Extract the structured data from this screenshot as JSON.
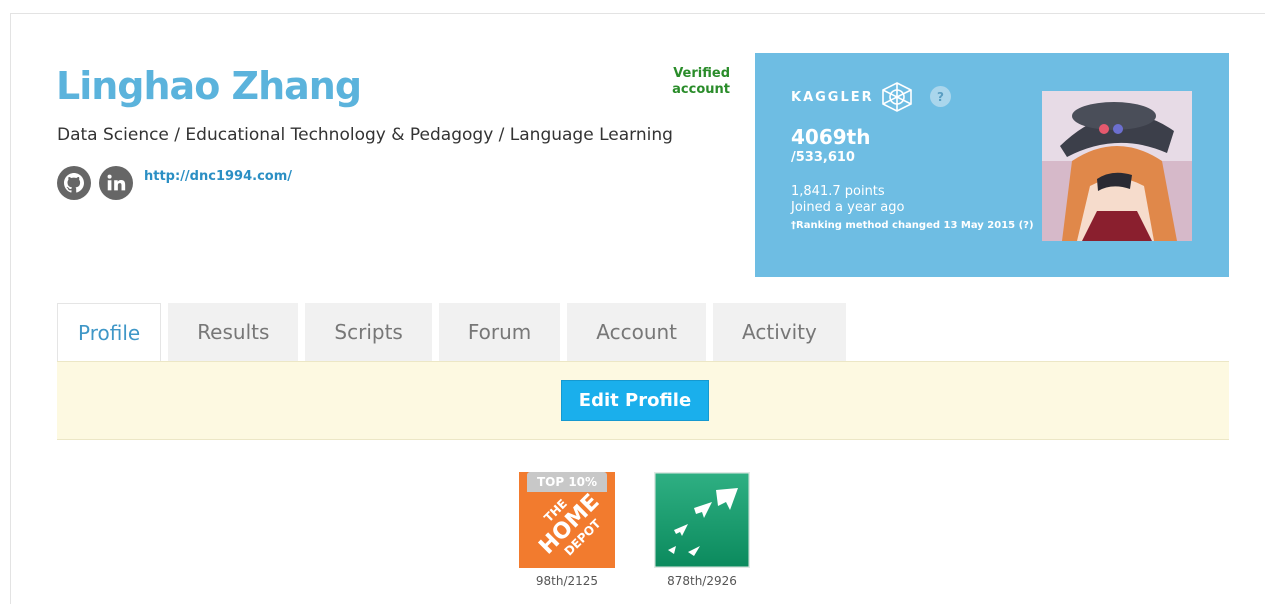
{
  "profile": {
    "name": "Linghao Zhang",
    "tagline": "Data Science / Educational Technology & Pedagogy / Language Learning",
    "website": "http://dnc1994.com/",
    "verified": "Verified account",
    "social_icons": [
      "github-icon",
      "linkedin-icon"
    ]
  },
  "card": {
    "label": "KAGGLER",
    "tier_icon": "kaggler-tier-icon",
    "help": "?",
    "rank": "4069th",
    "total": "/533,610",
    "points": "1,841.7 points",
    "joined": "Joined a year ago",
    "note": "†Ranking method changed 13 May 2015 (?)",
    "bg_color": "#6ebde3"
  },
  "tabs": [
    {
      "label": "Profile",
      "active": true
    },
    {
      "label": "Results"
    },
    {
      "label": "Scripts"
    },
    {
      "label": "Forum"
    },
    {
      "label": "Account"
    },
    {
      "label": "Activity"
    }
  ],
  "edit_button": "Edit Profile",
  "competitions": [
    {
      "logo": "home-depot-logo",
      "logo_text": [
        "THE",
        "HOME",
        "DEPOT"
      ],
      "tag": "TOP 10%",
      "rank": "98th/2125"
    },
    {
      "logo": "bnp-paribas-logo",
      "rank": "878th/2926"
    }
  ]
}
